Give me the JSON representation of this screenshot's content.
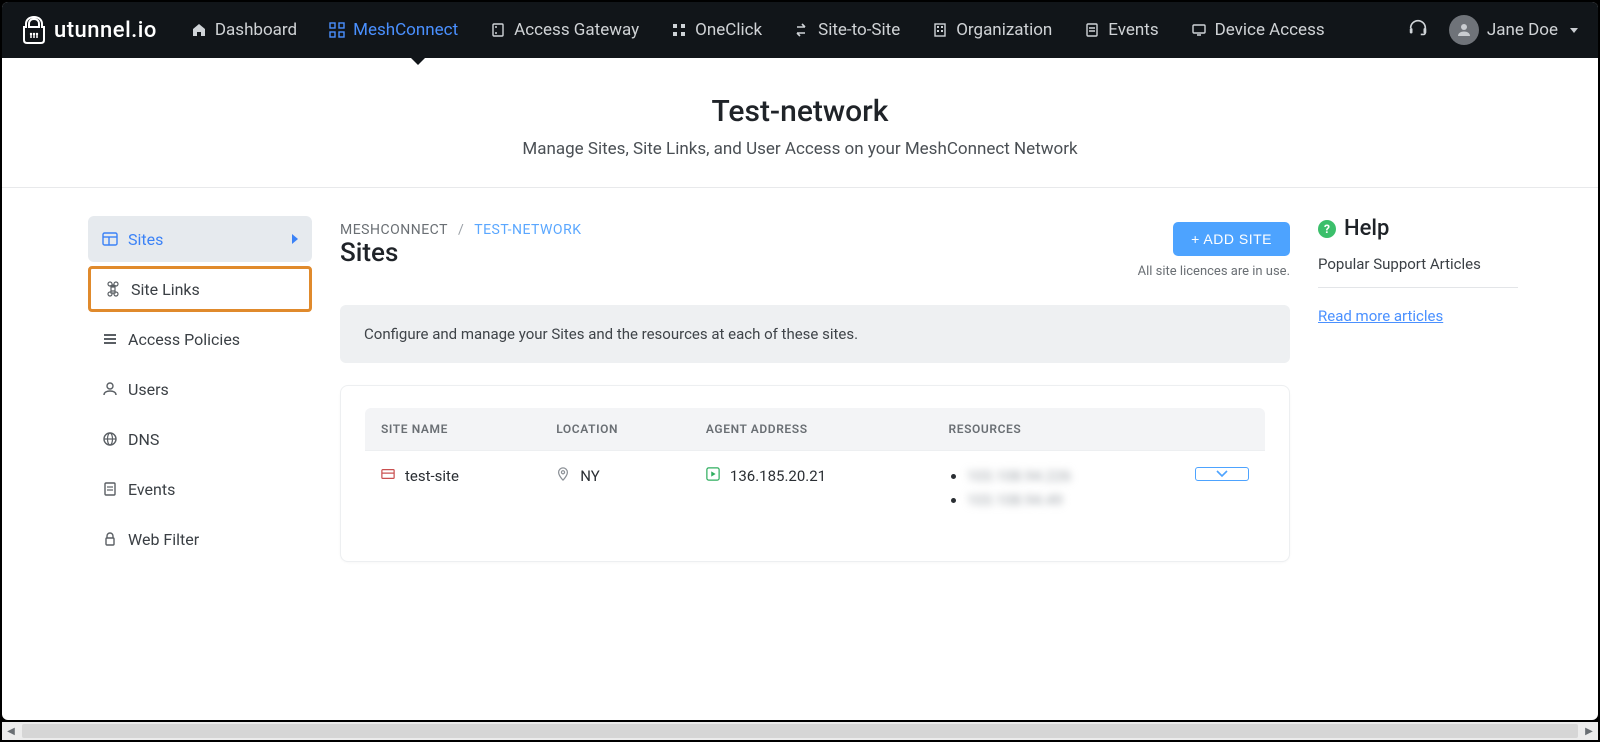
{
  "brand": {
    "name": "utunnel.io"
  },
  "nav": {
    "items": [
      {
        "label": "Dashboard"
      },
      {
        "label": "MeshConnect"
      },
      {
        "label": "Access Gateway"
      },
      {
        "label": "OneClick"
      },
      {
        "label": "Site-to-Site"
      },
      {
        "label": "Organization"
      },
      {
        "label": "Events"
      },
      {
        "label": "Device Access"
      }
    ]
  },
  "user": {
    "name": "Jane Doe"
  },
  "hero": {
    "title": "Test-network",
    "subtitle": "Manage Sites, Site Links, and User Access on your MeshConnect Network"
  },
  "sidebar": {
    "items": [
      {
        "label": "Sites"
      },
      {
        "label": "Site Links"
      },
      {
        "label": "Access Policies"
      },
      {
        "label": "Users"
      },
      {
        "label": "DNS"
      },
      {
        "label": "Events"
      },
      {
        "label": "Web Filter"
      }
    ]
  },
  "breadcrumb": {
    "root": "MESHCONNECT",
    "current": "TEST-NETWORK"
  },
  "page": {
    "title": "Sites",
    "add_button": "+ ADD SITE",
    "licence_note": "All site licences are in use.",
    "info": "Configure and manage your Sites and the resources at each of these sites."
  },
  "table": {
    "headers": {
      "site_name": "SITE NAME",
      "location": "LOCATION",
      "agent_address": "AGENT ADDRESS",
      "resources": "RESOURCES"
    },
    "rows": [
      {
        "site_name": "test-site",
        "location": "NY",
        "agent_address": "136.185.20.21",
        "resources": [
          "103.108.94.226",
          "103.108.94.49"
        ]
      }
    ]
  },
  "help": {
    "title": "Help",
    "popular": "Popular Support Articles",
    "read_more": "Read more articles"
  }
}
